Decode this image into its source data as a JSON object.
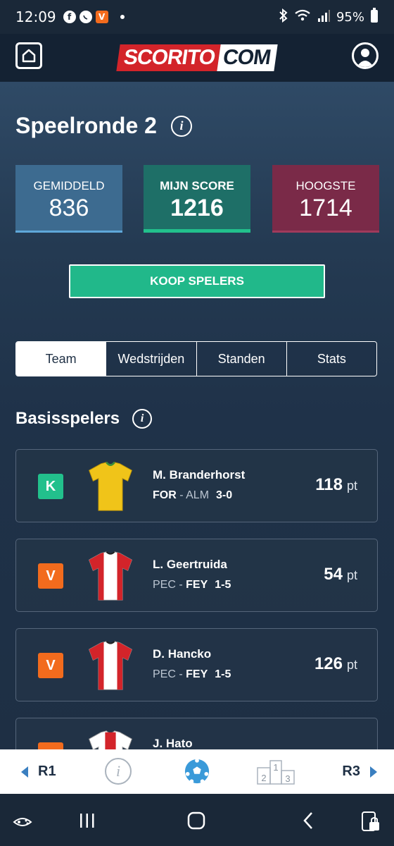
{
  "status_bar": {
    "time": "12:09",
    "battery": "95%",
    "app_icons": [
      "facebook-icon",
      "whatsapp-icon",
      "v-app-icon"
    ],
    "v_label": "V"
  },
  "app_bar": {
    "logo_left": "SCORITO",
    "logo_right": "COM"
  },
  "header": {
    "title": "Speelronde 2",
    "info_glyph": "i"
  },
  "scores": [
    {
      "label": "GEMIDDELD",
      "value": "836",
      "color": "#3d6b90"
    },
    {
      "label": "MIJN SCORE",
      "value": "1216",
      "color": "#1e6f67"
    },
    {
      "label": "HOOGSTE",
      "value": "1714",
      "color": "#7a2a48"
    }
  ],
  "buy_button": "KOOP SPELERS",
  "tabs": [
    "Team",
    "Wedstrijden",
    "Standen",
    "Stats"
  ],
  "section": {
    "title": "Basisspelers",
    "info_glyph": "i"
  },
  "players": [
    {
      "badge": "K",
      "name": "M. Branderhorst",
      "home": "FOR",
      "sep": " - ",
      "away": "ALM",
      "result": "3-0",
      "points": "118",
      "unit": "pt",
      "bold_side": "home",
      "shirt": "yellow"
    },
    {
      "badge": "V",
      "name": "L. Geertruida",
      "home": "PEC",
      "sep": " - ",
      "away": "FEY",
      "result": "1-5",
      "points": "54",
      "unit": "pt",
      "bold_side": "away",
      "shirt": "red-white"
    },
    {
      "badge": "V",
      "name": "D. Hancko",
      "home": "PEC",
      "sep": " - ",
      "away": "FEY",
      "result": "1-5",
      "points": "126",
      "unit": "pt",
      "bold_side": "away",
      "shirt": "red-white"
    },
    {
      "badge": "V",
      "name": "J. Hato",
      "home": "",
      "sep": "",
      "away": "",
      "result": "",
      "points": "",
      "unit": "",
      "bold_side": "none",
      "shirt": "ajax"
    }
  ],
  "bottom_nav": {
    "prev": "R1",
    "next": "R3",
    "info_glyph": "i",
    "podium": [
      "2",
      "1",
      "3"
    ]
  },
  "colors": {
    "accent_green": "#21b88a",
    "captain_badge": "#22c08c",
    "vice_badge": "#f26b1d",
    "brand_red": "#d3242a"
  }
}
